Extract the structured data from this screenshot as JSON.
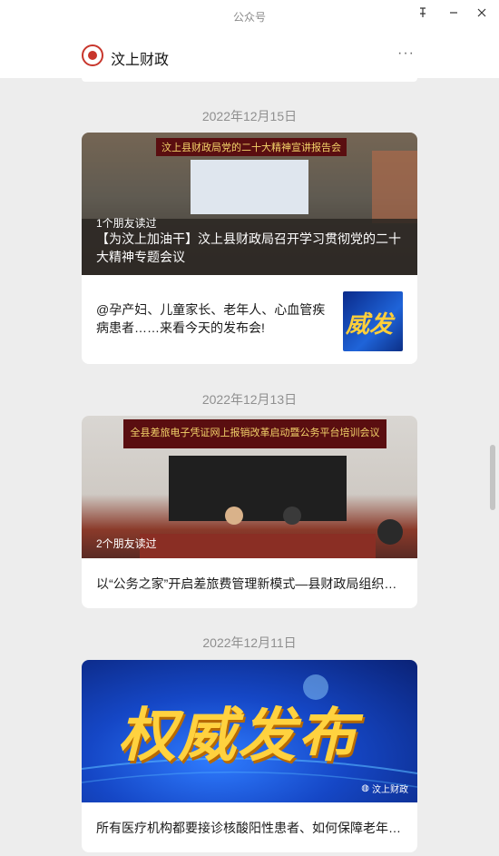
{
  "window": {
    "title": "公众号",
    "pin_icon": "pin-icon",
    "minimize_icon": "minimize-icon",
    "close_icon": "close-icon"
  },
  "header": {
    "account_name": "汶上财政",
    "more_label": "···"
  },
  "feed": [
    {
      "date": "2022年12月15日",
      "main": {
        "readers": "1个朋友读过",
        "title": "【为汶上加油干】汶上县财政局召开学习贯彻党的二十大精神专题会议",
        "banner_text": "汶上县财政局党的二十大精神宣讲报告会"
      },
      "sub": {
        "title": "@孕产妇、儿童家长、老年人、心血管疾病患者……来看今天的发布会!",
        "thumb_text": "威发"
      }
    },
    {
      "date": "2022年12月13日",
      "main": {
        "readers": "2个朋友读过",
        "title": "以“公务之家”开启差旅费管理新模式—县财政局组织…",
        "banner_text": "全县差旅电子凭证网上报销改革启动暨公务平台培训会议"
      }
    },
    {
      "date": "2022年12月11日",
      "main": {
        "cover_text": "权威发布",
        "watermark": "汶上财政",
        "title": "所有医疗机构都要接诊核酸阳性患者、如何保障老年…"
      }
    }
  ],
  "colors": {
    "background": "#ededed",
    "card": "#ffffff",
    "brand_red": "#c8362c",
    "date_gray": "#8f8f8f"
  }
}
